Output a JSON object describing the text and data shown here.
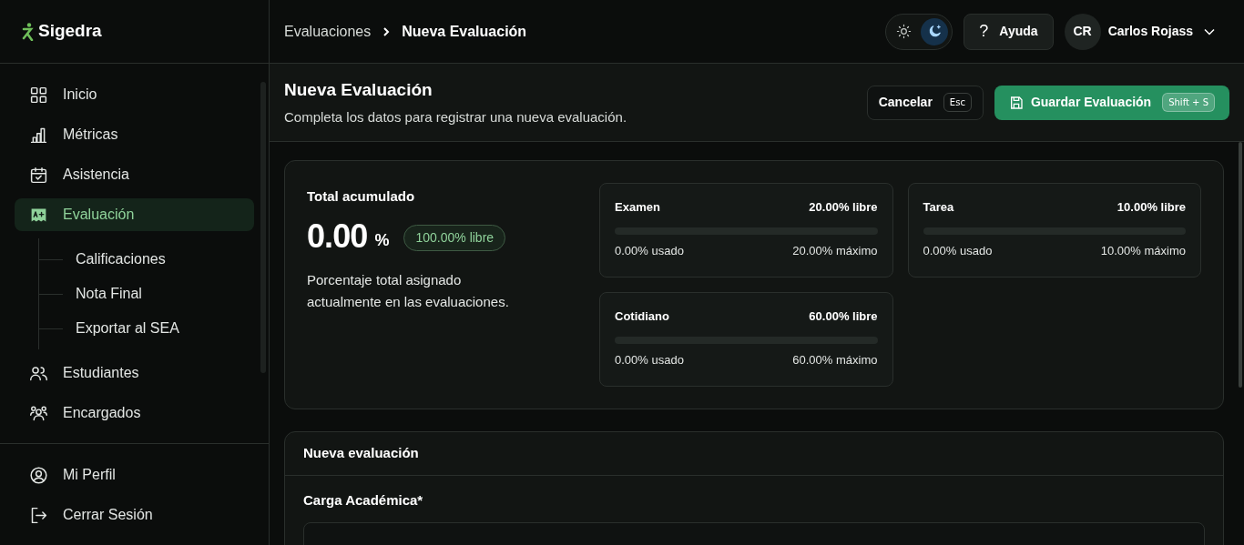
{
  "brand": {
    "name": "Sigedra"
  },
  "sidebar": {
    "items": [
      {
        "label": "Inicio",
        "selected": false
      },
      {
        "label": "Métricas",
        "selected": false
      },
      {
        "label": "Asistencia",
        "selected": false
      },
      {
        "label": "Evaluación",
        "selected": true,
        "children": [
          {
            "label": "Calificaciones"
          },
          {
            "label": "Nota Final"
          },
          {
            "label": "Exportar al SEA"
          }
        ]
      },
      {
        "label": "Estudiantes",
        "selected": false
      },
      {
        "label": "Encargados",
        "selected": false
      }
    ],
    "footer": [
      {
        "label": "Mi Perfil"
      },
      {
        "label": "Cerrar Sesión"
      }
    ]
  },
  "breadcrumb": [
    "Evaluaciones",
    "Nueva Evaluación"
  ],
  "theme_toggle": [
    {
      "selected": false
    },
    {
      "selected": true
    }
  ],
  "help_button": {
    "symbol": "?",
    "label": "Ayuda"
  },
  "user": {
    "initials": "CR",
    "name": "Carlos Rojass"
  },
  "page": {
    "title": "Nueva Evaluación",
    "subtitle": "Completa los datos para registrar una nueva evaluación.",
    "buttons": [
      {
        "kind": "secondary",
        "label": "Cancelar",
        "shortcut": "Esc"
      },
      {
        "kind": "primary",
        "label": "Guardar Evaluación",
        "shortcut": "Shift + S"
      }
    ]
  },
  "summary": {
    "title": "Total acumulado",
    "value": "0.00",
    "unit": "%",
    "badge": "100.00% libre",
    "description": "Porcentaje total asignado actualmente en las evaluaciones.",
    "categories": [
      {
        "name": "Examen",
        "free": "20.00% libre",
        "level": 0,
        "used": "0.00% usado",
        "max": "20.00% máximo"
      },
      {
        "name": "Tarea",
        "free": "10.00% libre",
        "level": 0,
        "used": "0.00% usado",
        "max": "10.00% máximo"
      },
      {
        "name": "Cotidiano",
        "free": "60.00% libre",
        "level": 0,
        "used": "0.00% usado",
        "max": "60.00% máximo"
      }
    ]
  },
  "form": {
    "title": "Nueva evaluación",
    "fields": [
      {
        "label": "Carga Académica*"
      }
    ]
  }
}
